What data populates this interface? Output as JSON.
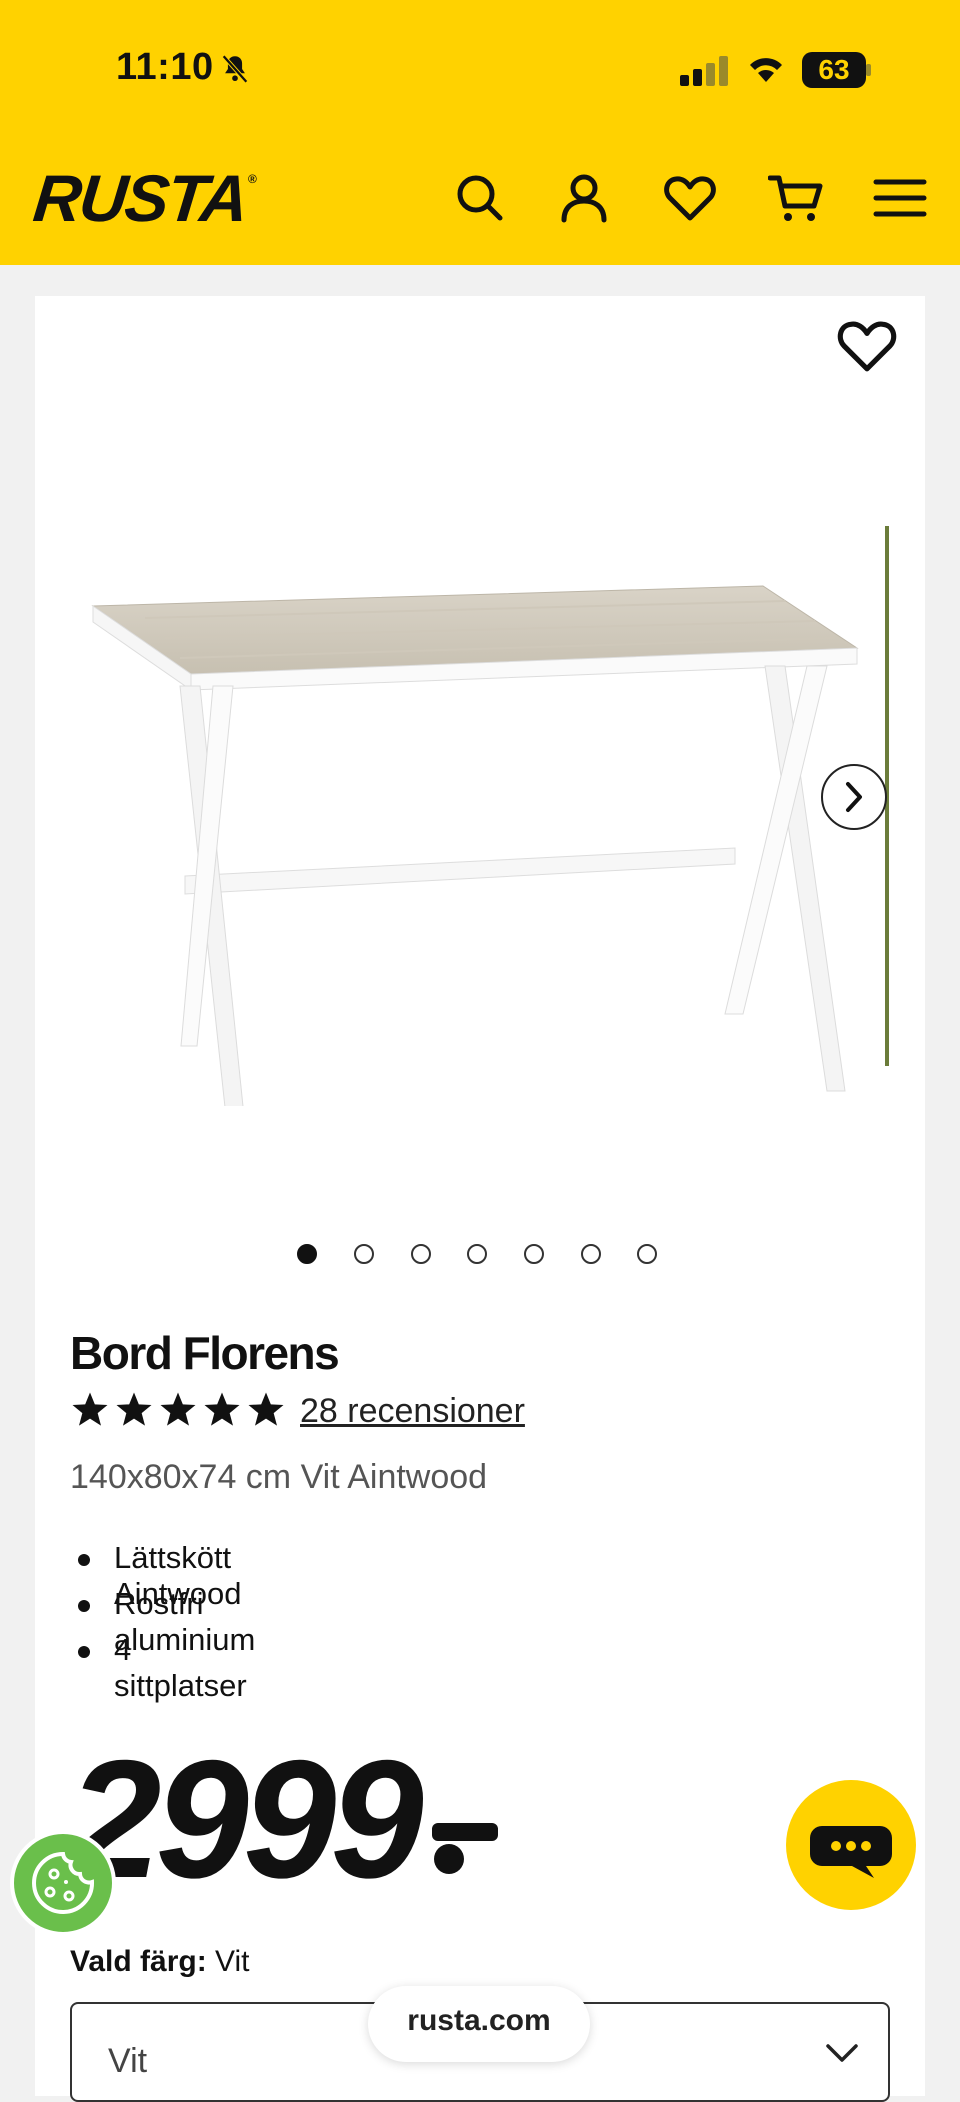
{
  "status_bar": {
    "time": "11:10",
    "battery": "63"
  },
  "header": {
    "logo": "RUSTA",
    "icons": [
      "search-icon",
      "account-icon",
      "wishlist-icon",
      "cart-icon",
      "menu-icon"
    ]
  },
  "product": {
    "image_count": 7,
    "active_image": 1,
    "name": "Bord Florens",
    "rating": 5,
    "reviews_label": "28 recensioner",
    "subtitle": "140x80x74 cm Vit Aintwood",
    "features": [
      "Lättskött Aintwood",
      "Rostfri aluminium",
      "4 sittplatser"
    ],
    "price": "2999"
  },
  "color_select": {
    "label": "Vald färg:",
    "value_label": "Vit",
    "selected": "Vit"
  },
  "browser": {
    "url": "rusta.com"
  },
  "colors": {
    "brand_yellow": "#ffd200",
    "cookie_green": "#6abf4b"
  }
}
